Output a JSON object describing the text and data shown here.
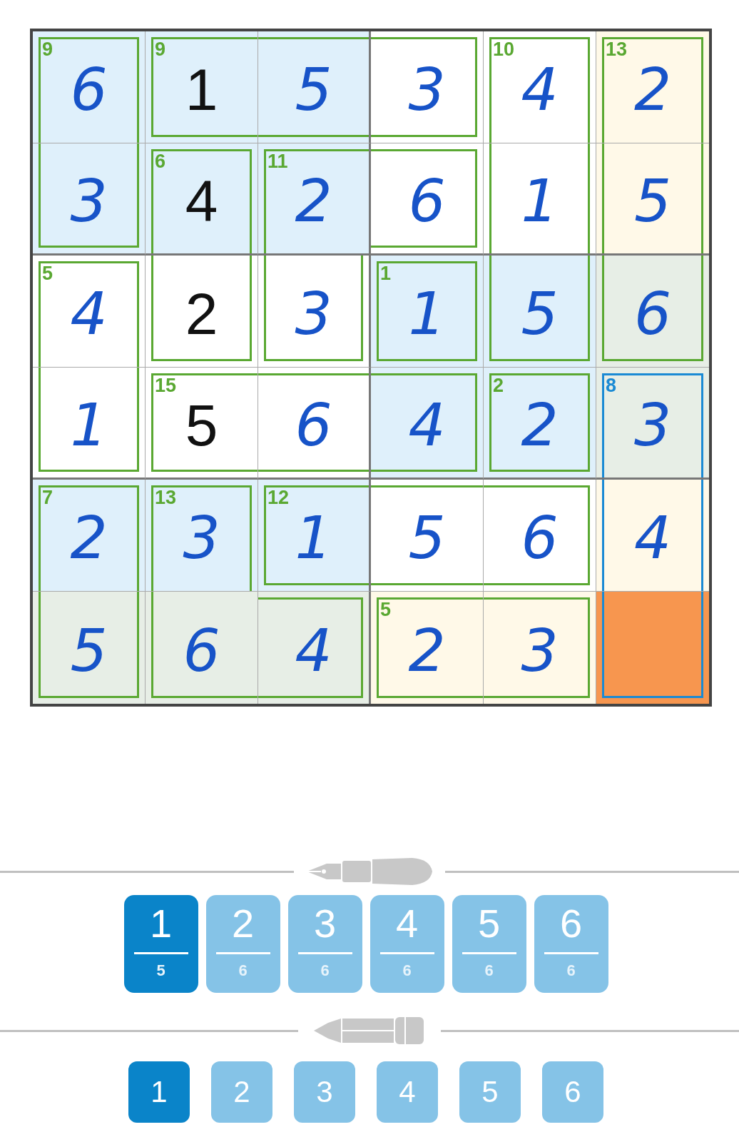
{
  "grid": {
    "rows": [
      {
        "cells": [
          {
            "value": "6",
            "kind": "entered",
            "color": "#dff0fb",
            "cage_sum": "9",
            "cage_selected": false,
            "wall_top": true,
            "wall_right": true,
            "wall_bottom": false,
            "wall_left": true
          },
          {
            "value": "1",
            "kind": "given",
            "color": "#dff0fb",
            "cage_sum": "9",
            "cage_selected": false,
            "wall_top": true,
            "wall_right": false,
            "wall_bottom": true,
            "wall_left": true
          },
          {
            "value": "5",
            "kind": "entered",
            "color": "#dff0fb",
            "cage_selected": false,
            "wall_top": true,
            "wall_right": false,
            "wall_bottom": true,
            "wall_left": false
          },
          {
            "value": "3",
            "kind": "entered",
            "color": "#ffffff",
            "cage_selected": false,
            "wall_top": true,
            "wall_right": true,
            "wall_bottom": true,
            "wall_left": false
          },
          {
            "value": "4",
            "kind": "entered",
            "color": "#ffffff",
            "cage_sum": "10",
            "cage_selected": false,
            "wall_top": true,
            "wall_right": true,
            "wall_bottom": false,
            "wall_left": true
          },
          {
            "value": "2",
            "kind": "entered",
            "color": "#fff9e8",
            "cage_sum": "13",
            "cage_selected": false,
            "wall_top": true,
            "wall_right": true,
            "wall_bottom": false,
            "wall_left": true
          }
        ]
      },
      {
        "cells": [
          {
            "value": "3",
            "kind": "entered",
            "color": "#dff0fb",
            "cage_selected": false,
            "wall_top": false,
            "wall_right": true,
            "wall_bottom": true,
            "wall_left": true
          },
          {
            "value": "4",
            "kind": "given",
            "color": "#dff0fb",
            "cage_sum": "6",
            "cage_selected": false,
            "wall_top": true,
            "wall_right": true,
            "wall_bottom": false,
            "wall_left": true
          },
          {
            "value": "2",
            "kind": "entered",
            "color": "#dff0fb",
            "cage_sum": "11",
            "cage_selected": false,
            "wall_top": true,
            "wall_right": false,
            "wall_bottom": false,
            "wall_left": true
          },
          {
            "value": "6",
            "kind": "entered",
            "color": "#ffffff",
            "cage_selected": false,
            "wall_top": true,
            "wall_right": true,
            "wall_bottom": true,
            "wall_left": false
          },
          {
            "value": "1",
            "kind": "entered",
            "color": "#ffffff",
            "cage_selected": false,
            "wall_top": false,
            "wall_right": true,
            "wall_bottom": false,
            "wall_left": true
          },
          {
            "value": "5",
            "kind": "entered",
            "color": "#fff9e8",
            "cage_selected": false,
            "wall_top": false,
            "wall_right": true,
            "wall_bottom": false,
            "wall_left": true
          }
        ]
      },
      {
        "cells": [
          {
            "value": "4",
            "kind": "entered",
            "color": "#ffffff",
            "cage_sum": "5",
            "cage_selected": false,
            "wall_top": true,
            "wall_right": true,
            "wall_bottom": false,
            "wall_left": true
          },
          {
            "value": "2",
            "kind": "given",
            "color": "#ffffff",
            "cage_selected": false,
            "wall_top": false,
            "wall_right": true,
            "wall_bottom": true,
            "wall_left": true
          },
          {
            "value": "3",
            "kind": "entered",
            "color": "#ffffff",
            "cage_selected": false,
            "wall_top": false,
            "wall_right": true,
            "wall_bottom": true,
            "wall_left": true
          },
          {
            "value": "1",
            "kind": "entered",
            "color": "#dff0fb",
            "cage_sum": "1",
            "cage_selected": false,
            "wall_top": true,
            "wall_right": true,
            "wall_bottom": true,
            "wall_left": true
          },
          {
            "value": "5",
            "kind": "entered",
            "color": "#dff0fb",
            "cage_selected": false,
            "wall_top": false,
            "wall_right": true,
            "wall_bottom": true,
            "wall_left": true
          },
          {
            "value": "6",
            "kind": "entered",
            "color": "#e7eee6",
            "cage_selected": false,
            "wall_top": false,
            "wall_right": true,
            "wall_bottom": true,
            "wall_left": true
          }
        ]
      },
      {
        "cells": [
          {
            "value": "1",
            "kind": "entered",
            "color": "#ffffff",
            "cage_selected": false,
            "wall_top": false,
            "wall_right": true,
            "wall_bottom": true,
            "wall_left": true
          },
          {
            "value": "5",
            "kind": "given",
            "color": "#ffffff",
            "cage_sum": "15",
            "cage_selected": false,
            "wall_top": true,
            "wall_right": false,
            "wall_bottom": true,
            "wall_left": true
          },
          {
            "value": "6",
            "kind": "entered",
            "color": "#ffffff",
            "cage_selected": false,
            "wall_top": true,
            "wall_right": false,
            "wall_bottom": true,
            "wall_left": false
          },
          {
            "value": "4",
            "kind": "entered",
            "color": "#dff0fb",
            "cage_selected": false,
            "wall_top": true,
            "wall_right": true,
            "wall_bottom": true,
            "wall_left": false
          },
          {
            "value": "2",
            "kind": "entered",
            "color": "#dff0fb",
            "cage_sum": "2",
            "cage_selected": false,
            "wall_top": true,
            "wall_right": true,
            "wall_bottom": true,
            "wall_left": true
          },
          {
            "value": "3",
            "kind": "entered",
            "color": "#e7eee6",
            "cage_sum": "8",
            "cage_selected": true,
            "wall_top": true,
            "wall_right": true,
            "wall_bottom": false,
            "wall_left": true
          }
        ]
      },
      {
        "cells": [
          {
            "value": "2",
            "kind": "entered",
            "color": "#dff0fb",
            "cage_sum": "7",
            "cage_selected": false,
            "wall_top": true,
            "wall_right": true,
            "wall_bottom": false,
            "wall_left": true
          },
          {
            "value": "3",
            "kind": "entered",
            "color": "#dff0fb",
            "cage_sum": "13",
            "cage_selected": false,
            "wall_top": true,
            "wall_right": true,
            "wall_bottom": false,
            "wall_left": true
          },
          {
            "value": "1",
            "kind": "entered",
            "color": "#dff0fb",
            "cage_sum": "12",
            "cage_selected": false,
            "wall_top": true,
            "wall_right": false,
            "wall_bottom": true,
            "wall_left": true
          },
          {
            "value": "5",
            "kind": "entered",
            "color": "#ffffff",
            "cage_selected": false,
            "wall_top": true,
            "wall_right": false,
            "wall_bottom": true,
            "wall_left": false
          },
          {
            "value": "6",
            "kind": "entered",
            "color": "#ffffff",
            "cage_selected": false,
            "wall_top": true,
            "wall_right": true,
            "wall_bottom": true,
            "wall_left": false
          },
          {
            "value": "4",
            "kind": "entered",
            "color": "#fff9e8",
            "cage_selected": true,
            "wall_top": false,
            "wall_right": true,
            "wall_bottom": false,
            "wall_left": true
          }
        ]
      },
      {
        "cells": [
          {
            "value": "5",
            "kind": "entered",
            "color": "#e7eee6",
            "cage_selected": false,
            "wall_top": false,
            "wall_right": true,
            "wall_bottom": true,
            "wall_left": true
          },
          {
            "value": "6",
            "kind": "entered",
            "color": "#e7eee6",
            "cage_selected": false,
            "wall_top": false,
            "wall_right": false,
            "wall_bottom": true,
            "wall_left": true
          },
          {
            "value": "4",
            "kind": "entered",
            "color": "#e7eee6",
            "cage_selected": false,
            "wall_top": true,
            "wall_right": true,
            "wall_bottom": true,
            "wall_left": false
          },
          {
            "value": "2",
            "kind": "entered",
            "color": "#fff9e8",
            "cage_sum": "5",
            "cage_selected": false,
            "wall_top": true,
            "wall_right": false,
            "wall_bottom": true,
            "wall_left": true
          },
          {
            "value": "3",
            "kind": "entered",
            "color": "#fff9e8",
            "cage_selected": false,
            "wall_top": true,
            "wall_right": true,
            "wall_bottom": true,
            "wall_left": false
          },
          {
            "kind": "empty",
            "color": "#f7964f",
            "cage_selected": true,
            "wall_top": false,
            "wall_right": true,
            "wall_bottom": true,
            "wall_left": true
          }
        ]
      }
    ]
  },
  "pen_digits": [
    {
      "label": "1",
      "count": "5",
      "selected": true
    },
    {
      "label": "2",
      "count": "6",
      "selected": false
    },
    {
      "label": "3",
      "count": "6",
      "selected": false
    },
    {
      "label": "4",
      "count": "6",
      "selected": false
    },
    {
      "label": "5",
      "count": "6",
      "selected": false
    },
    {
      "label": "6",
      "count": "6",
      "selected": false
    }
  ],
  "pencil_digits": [
    {
      "label": "1",
      "selected": true
    },
    {
      "label": "2",
      "selected": false
    },
    {
      "label": "3",
      "selected": false
    },
    {
      "label": "4",
      "selected": false
    },
    {
      "label": "5",
      "selected": false
    },
    {
      "label": "6",
      "selected": false
    }
  ]
}
